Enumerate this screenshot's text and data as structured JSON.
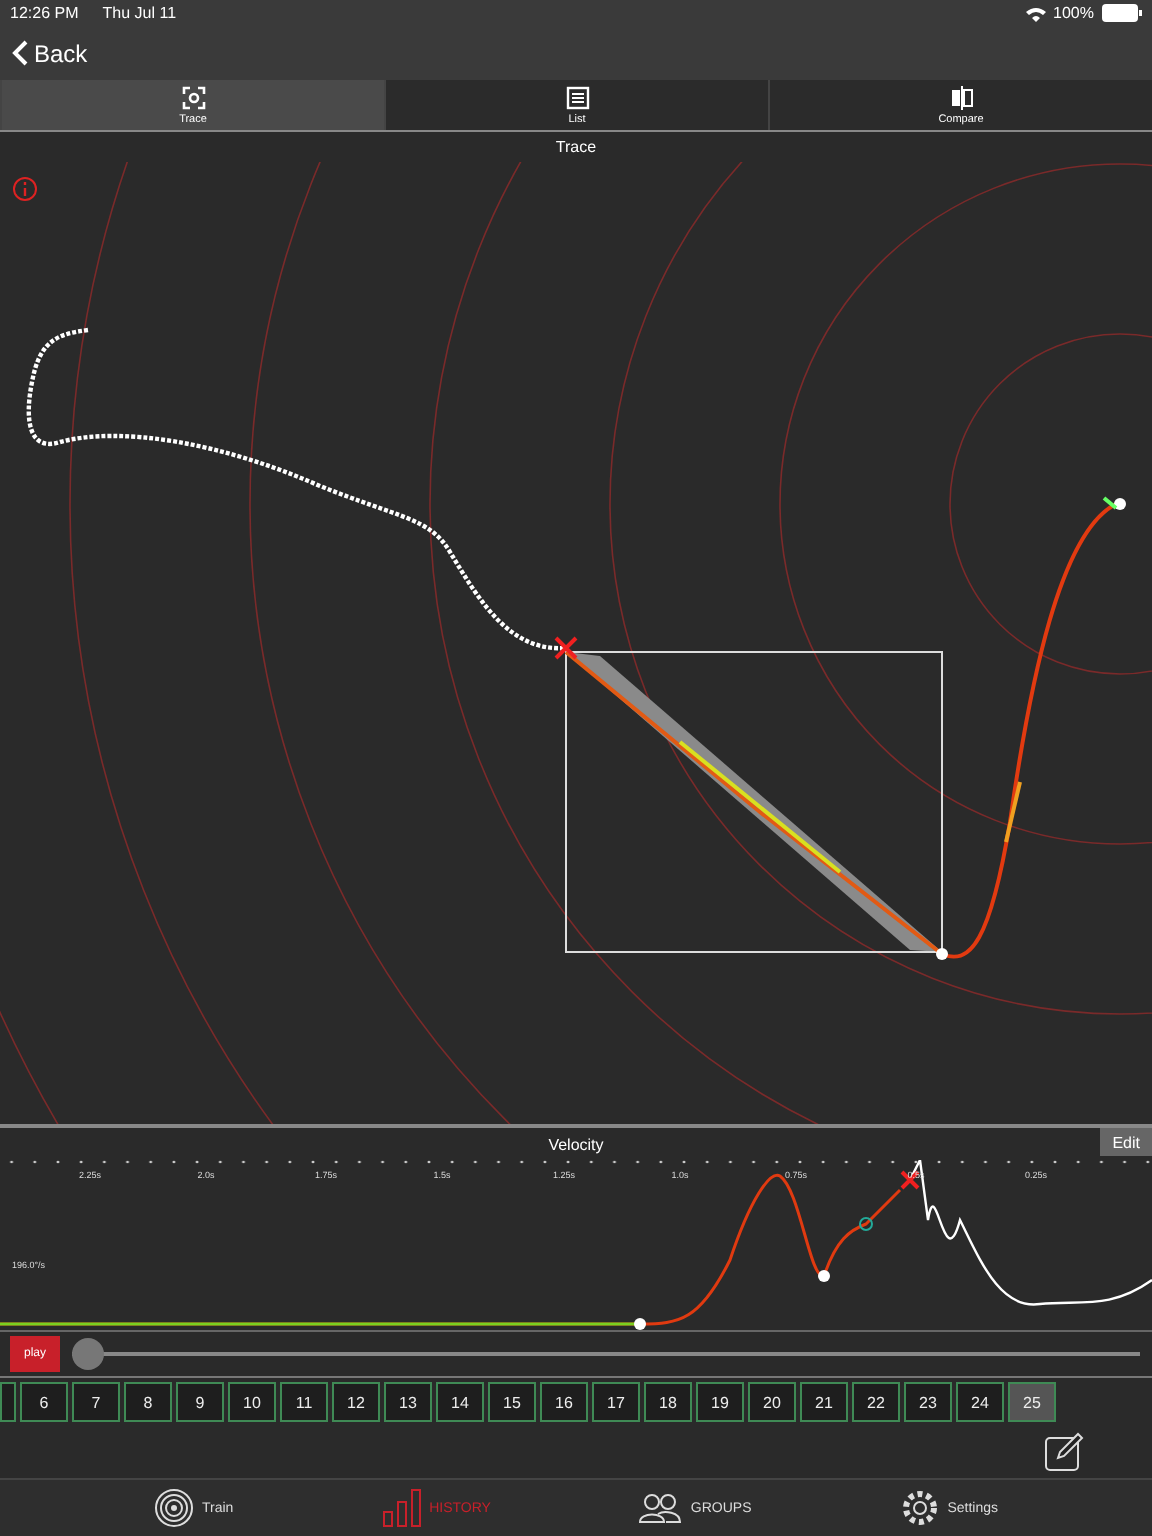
{
  "status_bar": {
    "time": "12:26 PM",
    "date": "Thu Jul 11",
    "battery": "100%"
  },
  "nav": {
    "back": "Back"
  },
  "tabs": [
    {
      "label": "Trace",
      "kind": "trace",
      "selected": true
    },
    {
      "label": "List",
      "kind": "list",
      "selected": false
    },
    {
      "label": "Compare",
      "kind": "compare",
      "selected": false
    }
  ],
  "trace": {
    "title": "Trace"
  },
  "velocity": {
    "title": "Velocity",
    "edit": "Edit",
    "ticks": [
      "2.25s",
      "2.0s",
      "1.75s",
      "1.5s",
      "1.25s",
      "1.0s",
      "0.75s",
      "0.5s",
      "0.25s"
    ],
    "y_label": "196.0°/s"
  },
  "player": {
    "play": "play",
    "level": 0
  },
  "shots": [
    {
      "selected": false
    },
    {
      "label": "6",
      "selected": false
    },
    {
      "label": "7",
      "selected": false
    },
    {
      "label": "8",
      "selected": false
    },
    {
      "label": "9",
      "selected": false
    },
    {
      "label": "10",
      "selected": false
    },
    {
      "label": "11",
      "selected": false
    },
    {
      "label": "12",
      "selected": false
    },
    {
      "label": "13",
      "selected": false
    },
    {
      "label": "14",
      "selected": false
    },
    {
      "label": "15",
      "selected": false
    },
    {
      "label": "16",
      "selected": false
    },
    {
      "label": "17",
      "selected": false
    },
    {
      "label": "18",
      "selected": false
    },
    {
      "label": "19",
      "selected": false
    },
    {
      "label": "20",
      "selected": false
    },
    {
      "label": "21",
      "selected": false
    },
    {
      "label": "22",
      "selected": false
    },
    {
      "label": "23",
      "selected": false
    },
    {
      "label": "24",
      "selected": false
    },
    {
      "label": "25",
      "selected": true
    }
  ],
  "bottom_tabs": [
    {
      "label": "Train",
      "kind": "train",
      "selected": false
    },
    {
      "label": "HISTORY",
      "kind": "history",
      "selected": true
    },
    {
      "label": "GROUPS",
      "kind": "groups",
      "selected": false
    },
    {
      "label": "Settings",
      "kind": "settings",
      "selected": false
    }
  ]
}
